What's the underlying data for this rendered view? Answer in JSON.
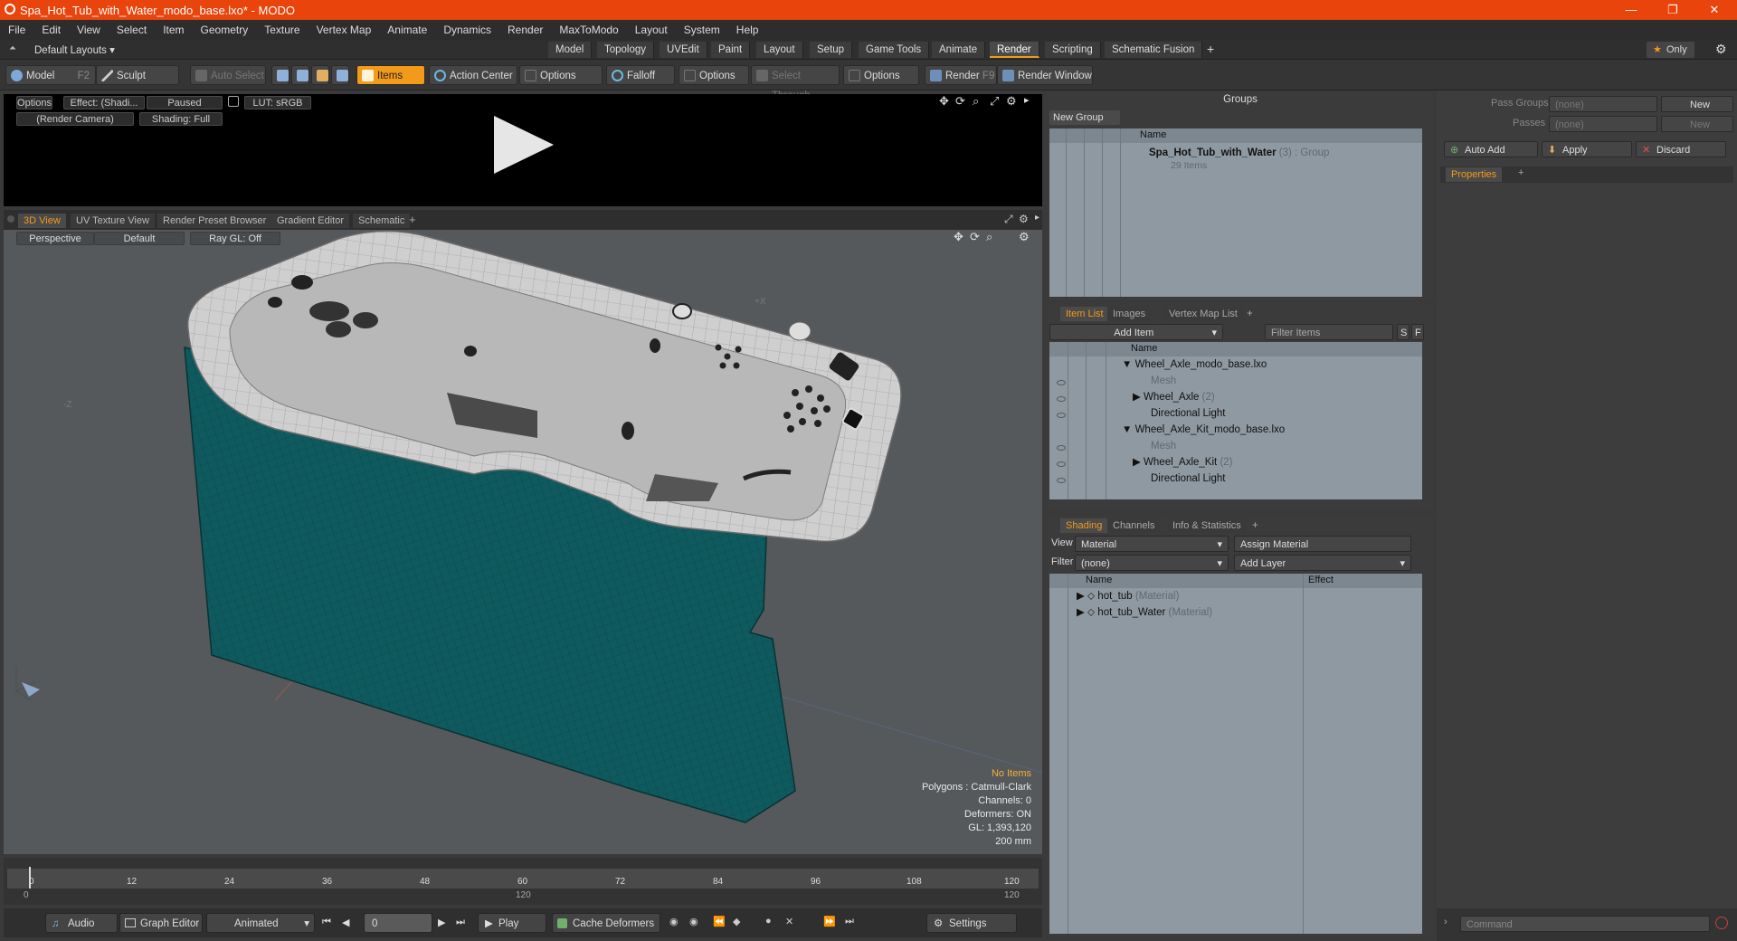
{
  "window": {
    "title": "Spa_Hot_Tub_with_Water_modo_base.lxo* - MODO",
    "minimize": "—",
    "restore": "❐",
    "close": "✕"
  },
  "menu": [
    "File",
    "Edit",
    "View",
    "Select",
    "Item",
    "Geometry",
    "Texture",
    "Vertex Map",
    "Animate",
    "Dynamics",
    "Render",
    "MaxToModo",
    "Layout",
    "System",
    "Help"
  ],
  "layouts": {
    "selector": "Default Layouts",
    "tabs": [
      "Model",
      "Topology",
      "UVEdit",
      "Paint",
      "Layout",
      "Setup",
      "Game Tools",
      "Animate",
      "Render",
      "Scripting",
      "Schematic Fusion"
    ],
    "active": "Render",
    "add": "+",
    "only": "Only"
  },
  "toolbar": {
    "model": "Model",
    "model_key": "F2",
    "sculpt": "Sculpt",
    "auto_select": "Auto Select",
    "items": "Items",
    "action_center": "Action Center",
    "options1": "Options",
    "falloff": "Falloff",
    "options2": "Options",
    "select_through": "Select Through",
    "options3": "Options",
    "render": "Render",
    "render_key": "F9",
    "render_window": "Render Window"
  },
  "preview": {
    "options": "Options",
    "effect": "Effect: (Shadi...",
    "paused": "Paused",
    "lut": "LUT: sRGB",
    "camera": "(Render Camera)",
    "shading": "Shading: Full"
  },
  "viewport_tabs": [
    "3D View",
    "UV Texture View",
    "Render Preset Browser",
    "Gradient Editor",
    "Schematic",
    "+"
  ],
  "viewport": {
    "projection": "Perspective",
    "style": "Default",
    "raygl": "Ray GL: Off",
    "axis_x": "+X",
    "axis_z": "-Z",
    "stats": [
      "No Items",
      "Polygons : Catmull-Clark",
      "Channels: 0",
      "Deformers: ON",
      "GL: 1,393,120",
      "200 mm"
    ]
  },
  "timeline": {
    "ticks": [
      "0",
      "12",
      "24",
      "36",
      "48",
      "60",
      "72",
      "84",
      "96",
      "108",
      "120"
    ],
    "sub_start": "0",
    "sub_mid": "120",
    "sub_end": "120"
  },
  "bottom": {
    "audio": "Audio",
    "graph_editor": "Graph Editor",
    "animated": "Animated",
    "frame": "0",
    "play": "Play",
    "cache": "Cache Deformers",
    "settings": "Settings"
  },
  "groups": {
    "title": "Groups",
    "new_group": "New Group",
    "col_name": "Name",
    "item_name": "Spa_Hot_Tub_with_Water",
    "item_count": "(3)",
    "item_type": ": Group",
    "item_sub": "29 Items"
  },
  "itemlist": {
    "tabs": [
      "Item List",
      "Images",
      "Vertex Map List",
      "+"
    ],
    "add_item": "Add Item",
    "filter": "Filter Items",
    "col_name": "Name",
    "s": "S",
    "f": "F",
    "rows": [
      {
        "name": "Wheel_Axle_modo_base.lxo",
        "suffix": ""
      },
      {
        "name": "Mesh",
        "suffix": ""
      },
      {
        "name": "Wheel_Axle",
        "suffix": "(2)"
      },
      {
        "name": "Directional Light",
        "suffix": ""
      },
      {
        "name": "Wheel_Axle_Kit_modo_base.lxo",
        "suffix": ""
      },
      {
        "name": "Mesh",
        "suffix": ""
      },
      {
        "name": "Wheel_Axle_Kit",
        "suffix": "(2)"
      },
      {
        "name": "Directional Light",
        "suffix": ""
      }
    ]
  },
  "shading": {
    "tabs": [
      "Shading",
      "Channels",
      "Info & Statistics",
      "+"
    ],
    "view_label": "View",
    "view_value": "Material",
    "assign": "Assign Material",
    "filter_label": "Filter",
    "filter_value": "(none)",
    "add_layer": "Add Layer",
    "col_name": "Name",
    "col_effect": "Effect",
    "rows": [
      {
        "name": "hot_tub",
        "type": "(Material)"
      },
      {
        "name": "hot_tub_Water",
        "type": "(Material)"
      }
    ]
  },
  "passes": {
    "pass_groups": "Pass Groups",
    "passes": "Passes",
    "none1": "(none)",
    "none2": "(none)",
    "new1": "New",
    "new2": "New",
    "auto_add": "Auto Add",
    "apply": "Apply",
    "discard": "Discard",
    "properties": "Properties",
    "command": "Command"
  },
  "colors": {
    "accent": "#f29a1a",
    "title": "#e8440c",
    "tub_side": "#0f5a5e",
    "panel": "#8e99a1"
  }
}
